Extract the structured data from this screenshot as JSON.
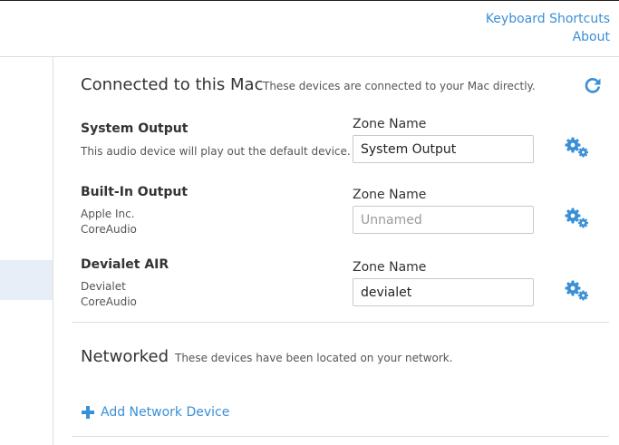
{
  "header": {
    "links": [
      "Keyboard Shortcuts",
      "About"
    ]
  },
  "connected": {
    "title": "Connected to this Mac",
    "subtitle": "These devices are connected to your Mac directly.",
    "refresh_icon": "refresh-icon",
    "devices": [
      {
        "name": "System Output",
        "meta": [
          "This audio device will play out the default device."
        ],
        "zone_label": "Zone Name",
        "zone_value": "System Output",
        "zone_placeholder": "",
        "settings_icon": "gears-icon"
      },
      {
        "name": "Built-In Output",
        "meta": [
          "Apple Inc.",
          "CoreAudio"
        ],
        "zone_label": "Zone Name",
        "zone_value": "",
        "zone_placeholder": "Unnamed",
        "settings_icon": "gears-icon"
      },
      {
        "name": "Devialet AIR",
        "meta": [
          "Devialet",
          "CoreAudio"
        ],
        "zone_label": "Zone Name",
        "zone_value": "devialet",
        "zone_placeholder": "",
        "settings_icon": "gears-icon"
      }
    ]
  },
  "networked": {
    "title": "Networked",
    "subtitle": "These devices have been located on your network.",
    "add_label": "Add Network Device",
    "add_icon": "plus-icon"
  },
  "colors": {
    "accent": "#3a8fd6",
    "selected_bg": "#e7eef7",
    "divider": "#dedede"
  }
}
